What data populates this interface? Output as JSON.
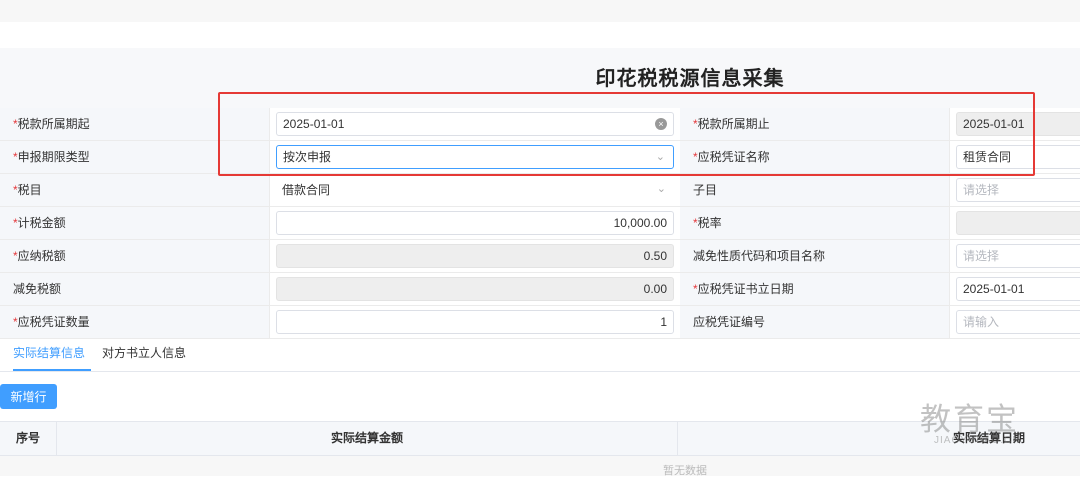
{
  "page": {
    "title": "印花税税源信息采集"
  },
  "form": {
    "rows": [
      {
        "label1": "税款所属期起",
        "required1": true,
        "value1": "2025-01-01",
        "type1": "date-clear",
        "label2": "税款所属期止",
        "required2": true,
        "value2": "2025-01-01",
        "type2": "disabled"
      },
      {
        "label1": "申报期限类型",
        "required1": true,
        "value1": "按次申报",
        "type1": "select-focused",
        "label2": "应税凭证名称",
        "required2": true,
        "value2": "租赁合同",
        "type2": "text"
      },
      {
        "label1": "税目",
        "required1": true,
        "value1": "借款合同",
        "type1": "select-plain",
        "label2": "子目",
        "required2": false,
        "value2": "请选择",
        "type2": "placeholder"
      },
      {
        "label1": "计税金额",
        "required1": true,
        "value1": "10,000.00",
        "type1": "number",
        "label2": "税率",
        "required2": true,
        "value2": "",
        "type2": "disabled"
      },
      {
        "label1": "应纳税额",
        "required1": true,
        "value1": "0.50",
        "type1": "number-disabled",
        "label2": "减免性质代码和项目名称",
        "required2": false,
        "value2": "请选择",
        "type2": "placeholder"
      },
      {
        "label1": "减免税额",
        "required1": false,
        "value1": "0.00",
        "type1": "number-disabled",
        "label2": "应税凭证书立日期",
        "required2": true,
        "value2": "2025-01-01",
        "type2": "text"
      },
      {
        "label1": "应税凭证数量",
        "required1": true,
        "value1": "1",
        "type1": "number",
        "label2": "应税凭证编号",
        "required2": false,
        "value2": "请输入",
        "type2": "placeholder"
      }
    ],
    "required_mark": "*"
  },
  "tabs": [
    {
      "label": "实际结算信息",
      "active": true
    },
    {
      "label": "对方书立人信息",
      "active": false
    }
  ],
  "toolbar": {
    "add_row_label": "新增行"
  },
  "table": {
    "columns": [
      "序号",
      "实际结算金额",
      "实际结算日期"
    ],
    "empty_text": "暂无数据"
  },
  "watermark": {
    "main": "教育宝",
    "sub": "JIAOYUBAO.CN"
  },
  "colors": {
    "accent": "#409eff",
    "required": "#e4393c",
    "annotation": "#e53935"
  }
}
